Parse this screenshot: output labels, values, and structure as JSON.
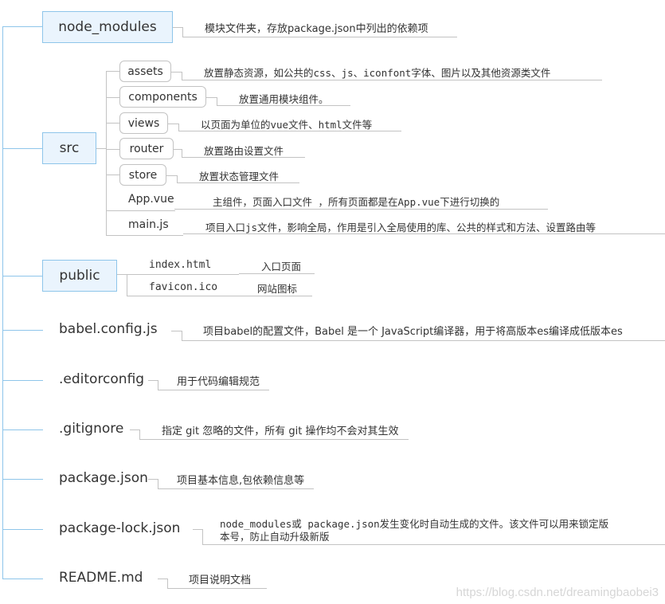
{
  "root_items": [
    {
      "name": "node_modules",
      "note": "模块文件夹，存放package.json中列出的依赖项"
    },
    {
      "name": "src",
      "children": [
        {
          "name": "assets",
          "note": "放置静态资源，如公共的css、js、iconfont字体、图片以及其他资源类文件"
        },
        {
          "name": "components",
          "note": "放置通用模块组件。"
        },
        {
          "name": "views",
          "note": "以页面为单位的vue文件、html文件等"
        },
        {
          "name": "router",
          "note": "放置路由设置文件"
        },
        {
          "name": "store",
          "note": "放置状态管理文件"
        },
        {
          "name": "App.vue",
          "note": "主组件，页面入口文件 ，所有页面都是在App.vue下进行切换的"
        },
        {
          "name": "main.js",
          "note": "项目入口js文件，影响全局，作用是引入全局使用的库、公共的样式和方法、设置路由等"
        }
      ]
    },
    {
      "name": "public",
      "children": [
        {
          "name": "index.html",
          "note": "入口页面"
        },
        {
          "name": "favicon.ico",
          "note": "网站图标"
        }
      ]
    },
    {
      "name": "babel.config.js",
      "note": "项目babel的配置文件，Babel 是一个 JavaScript编译器，用于将高版本es编译成低版本es"
    },
    {
      "name": ".editorconfig",
      "note": "用于代码编辑规范"
    },
    {
      "name": ".gitignore",
      "note": "指定 git 忽略的文件，所有 git 操作均不会对其生效"
    },
    {
      "name": "package.json",
      "note": "项目基本信息,包依赖信息等"
    },
    {
      "name": "package-lock.json",
      "note_line1": "node_modules或 package.json发生变化时自动生成的文件。该文件可以用来锁定版",
      "note_line2": "本号，防止自动升级新版"
    },
    {
      "name": "README.md",
      "note": "项目说明文档"
    }
  ],
  "watermark": "https://blog.csdn.net/dreamingbaobei3",
  "colors": {
    "topic_fill": "#eaf4fd",
    "topic_border": "#8ec5ea",
    "branch_gray": "#c3c3c3"
  }
}
